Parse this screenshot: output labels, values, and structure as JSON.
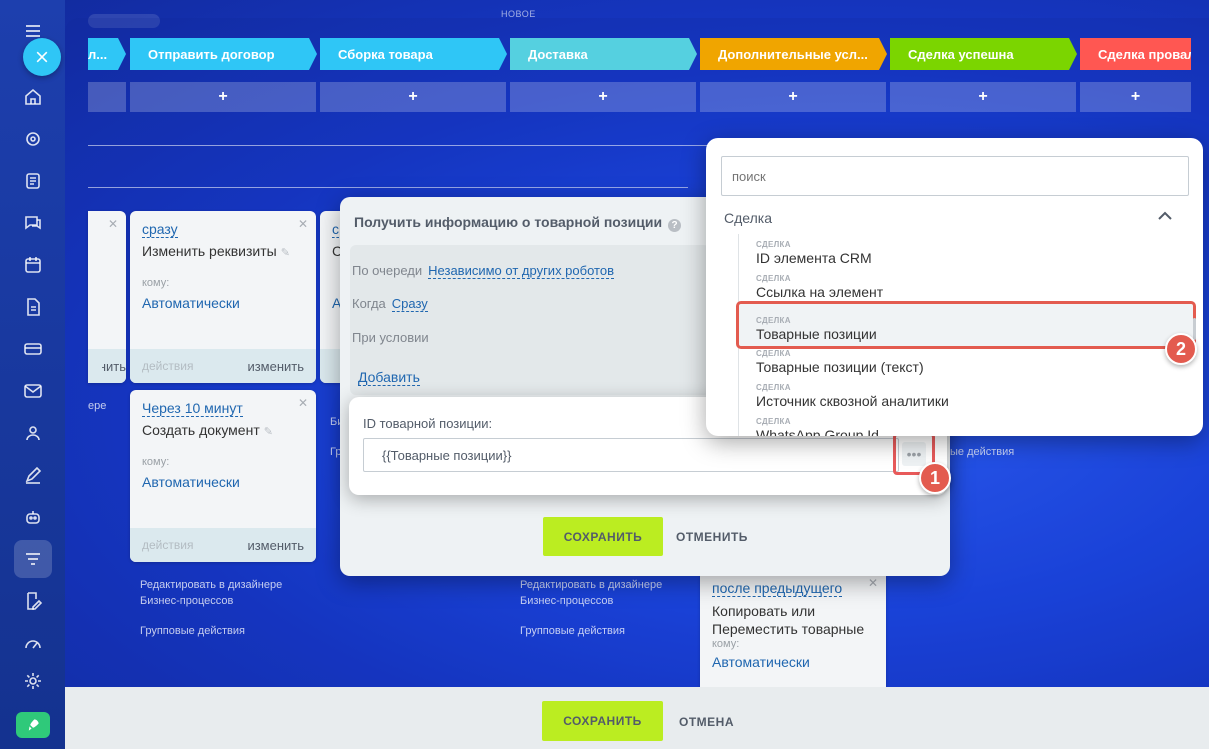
{
  "colors": {
    "stage_prev": "#2fc6f6",
    "stage_contract": "#2fc6f6",
    "stage_assembly": "#2fc6f6",
    "stage_delivery": "#55d0e0",
    "stage_extra": "#f0a500",
    "stage_success": "#7bd500",
    "stage_fail": "#ff5752",
    "accent_link": "#2067b0",
    "save_button": "#bbed21",
    "highlight": "#e35b4f"
  },
  "header": {
    "top_label": "НОВОЕ"
  },
  "stages": [
    {
      "name": "Отправить договор"
    },
    {
      "name": "Сборка товара"
    },
    {
      "name": "Доставка"
    },
    {
      "name": "Дополнительные усл..."
    },
    {
      "name": "Сделка успешна"
    },
    {
      "name": "Сделка провал"
    }
  ],
  "stage_prev_text": "л...",
  "plus_symbol": "+",
  "cards": [
    {
      "trigger": "сразу",
      "title": "Изменить реквизиты",
      "to_label": "кому:",
      "who": "Автоматически",
      "actions": "действия",
      "edit": "изменить"
    },
    {
      "trigger": "Через 10 минут",
      "title": "Создать документ",
      "to_label": "кому:",
      "who": "Автоматически",
      "actions": "действия",
      "edit": "изменить"
    },
    {
      "trigger": "после предыдущего",
      "title": "Копировать или Переместить товарные",
      "to_label": "кому:",
      "who": "Автоматически"
    }
  ],
  "partial_texts": {
    "left_card_foot": "изменить",
    "left_link": "ере",
    "col3_link_1": "Би",
    "col3_link_2": "Гр",
    "col3_card_trigger": "с",
    "col3_card_title": "С",
    "col3_card_who": "А",
    "col7_group_actions": "ые действия"
  },
  "links": {
    "edit_in_designer": "Редактировать в дизайнере Бизнес-процессов",
    "group_actions": "Групповые действия"
  },
  "robot_popup": {
    "title": "Получить информацию о товарной позиции",
    "help_icon": "?",
    "queue_label": "По очереди",
    "queue_value": "Независимо от других роботов",
    "when_label": "Когда",
    "when_value": "Сразу",
    "condition_label": "При условии",
    "add_label": "Добавить",
    "field_label": "ID товарной позиции:",
    "field_value": "{{Товарные позиции}}",
    "dots": "•••",
    "save": "СОХРАНИТЬ",
    "cancel": "ОТМЕНИТЬ"
  },
  "dropdown": {
    "search_placeholder": "поиск",
    "section": "Сделка",
    "items": [
      {
        "category": "СДЕЛКА",
        "name": "ID элемента CRM"
      },
      {
        "category": "СДЕЛКА",
        "name": "Ссылка на элемент"
      },
      {
        "category": "СДЕЛКА",
        "name": "Товарные позиции"
      },
      {
        "category": "СДЕЛКА",
        "name": "Товарные позиции (текст)"
      },
      {
        "category": "СДЕЛКА",
        "name": "Источник сквозной аналитики"
      },
      {
        "category": "СДЕЛКА",
        "name": "WhatsApp Group Id"
      }
    ]
  },
  "badges": [
    "1",
    "2"
  ],
  "bottom_bar": {
    "save": "СОХРАНИТЬ",
    "cancel": "ОТМЕНА"
  }
}
